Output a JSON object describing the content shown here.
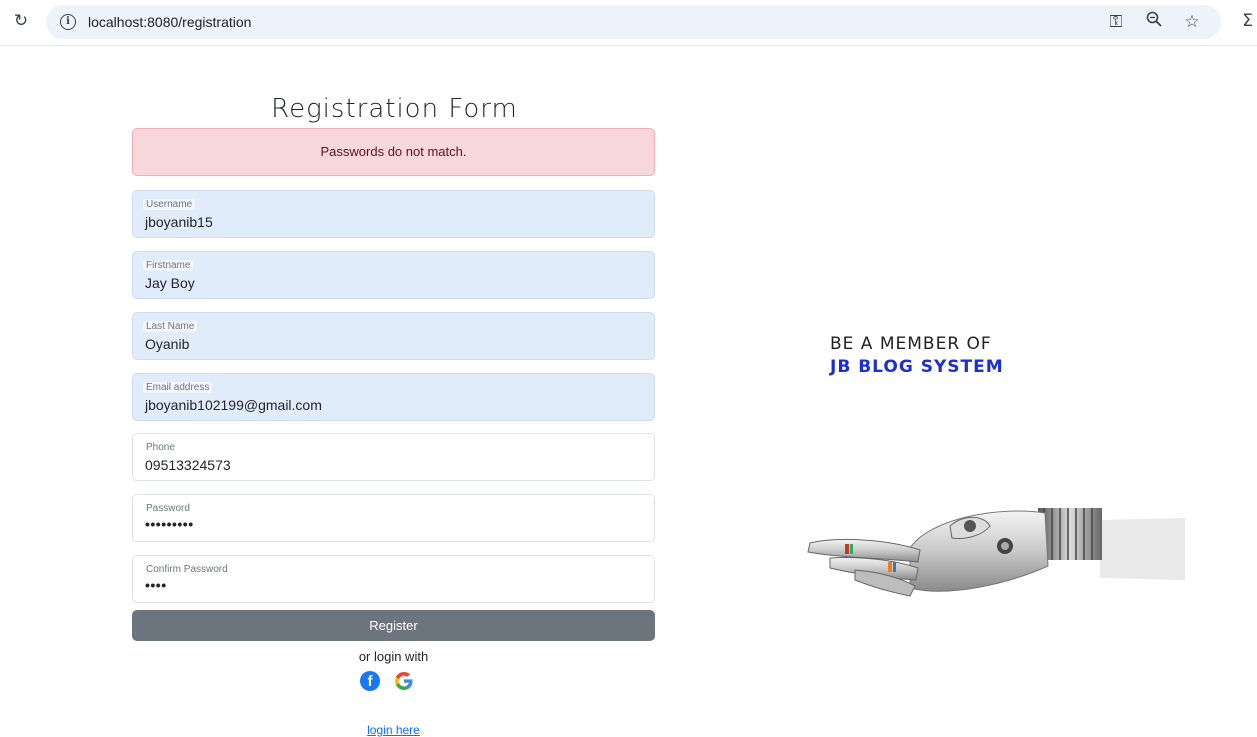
{
  "browser": {
    "url": "localhost:8080/registration"
  },
  "form": {
    "title": "Registration Form",
    "alert": "Passwords do not match.",
    "fields": [
      {
        "label": "Username",
        "value": "jboyanib15"
      },
      {
        "label": "Firstname",
        "value": "Jay Boy"
      },
      {
        "label": "Last Name",
        "value": "Oyanib"
      },
      {
        "label": "Email address",
        "value": "jboyanib102199@gmail.com"
      },
      {
        "label": "Phone",
        "value": "09513324573"
      },
      {
        "label": "Password",
        "value": "•••••••••"
      },
      {
        "label": "Confirm Password",
        "value": "••••"
      }
    ],
    "register_label": "Register",
    "or_text": "or login with",
    "login_link": "login here"
  },
  "promo": {
    "line1": "BE A MEMBER OF",
    "line2": "JB BLOG SYSTEM"
  },
  "colors": {
    "alert_bg": "#f8d7da",
    "autofill_bg": "#e1ecfa",
    "register_bg": "#6c757d",
    "promo_accent": "#1a2fd6",
    "link": "#0d6efd"
  },
  "icons": [
    "reload-icon",
    "info-icon",
    "key-icon",
    "zoom-icon",
    "star-icon",
    "extensions-icon",
    "facebook-icon",
    "google-icon"
  ]
}
